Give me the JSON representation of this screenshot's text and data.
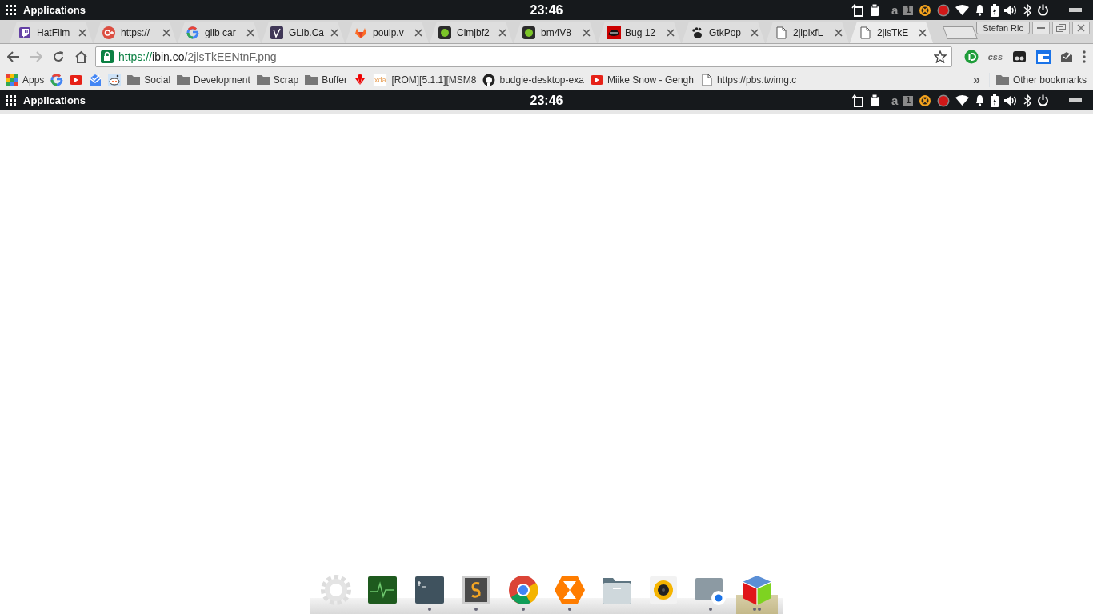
{
  "top_panel": {
    "menu_label": "Applications",
    "clock": "23:46",
    "keyboard_layout": "a",
    "workspace": "1"
  },
  "tabs": [
    {
      "title": "HatFilm",
      "selected": false
    },
    {
      "title": "https://",
      "selected": false
    },
    {
      "title": "glib car",
      "selected": false
    },
    {
      "title": "GLib.Ca",
      "selected": false
    },
    {
      "title": "poulp.v",
      "selected": false
    },
    {
      "title": "Cimjbf2",
      "selected": false
    },
    {
      "title": "bm4V8",
      "selected": false
    },
    {
      "title": "Bug 12",
      "selected": false
    },
    {
      "title": "GtkPop",
      "selected": false
    },
    {
      "title": "2jlpixfL",
      "selected": false
    },
    {
      "title": "2jlsTkE",
      "selected": true
    }
  ],
  "profile_button": "Stefan Ric",
  "toolbar": {
    "back_disabled": false,
    "forward_disabled": true,
    "url_scheme": "https://",
    "url_host": "ibin.co",
    "url_path": "/2jlsTkEENtnF.png",
    "extension_label": "css"
  },
  "bookmarks": [
    {
      "kind": "apps",
      "label": "Apps"
    },
    {
      "kind": "site"
    },
    {
      "kind": "site"
    },
    {
      "kind": "site"
    },
    {
      "kind": "site"
    },
    {
      "kind": "folder",
      "label": "Social"
    },
    {
      "kind": "folder",
      "label": "Development"
    },
    {
      "kind": "folder",
      "label": "Scrap"
    },
    {
      "kind": "folder",
      "label": "Buffer"
    },
    {
      "kind": "site"
    },
    {
      "kind": "xda",
      "icon_text": "xda",
      "label": "[ROM][5.1.1][MSM8"
    },
    {
      "kind": "site",
      "label": "budgie-desktop-exa"
    },
    {
      "kind": "site",
      "label": "Miike Snow - Gengh"
    },
    {
      "kind": "page",
      "label": "https://pbs.twimg.c"
    }
  ],
  "bookmarks_overflow": "»",
  "other_bookmarks": "Other bookmarks",
  "page": {
    "panel": {
      "menu_label": "Applications",
      "clock": "23:46",
      "keyboard_layout": "a",
      "workspace": "1"
    }
  },
  "dock": {
    "items": [
      {
        "running": false,
        "active": false
      },
      {
        "running": false,
        "active": false
      },
      {
        "running": true,
        "active": false
      },
      {
        "running": true,
        "active": false
      },
      {
        "running": true,
        "active": false
      },
      {
        "running": true,
        "active": false
      },
      {
        "running": false,
        "active": false
      },
      {
        "running": false,
        "active": false
      },
      {
        "running": true,
        "active": false
      },
      {
        "running": true,
        "active": true
      }
    ]
  }
}
